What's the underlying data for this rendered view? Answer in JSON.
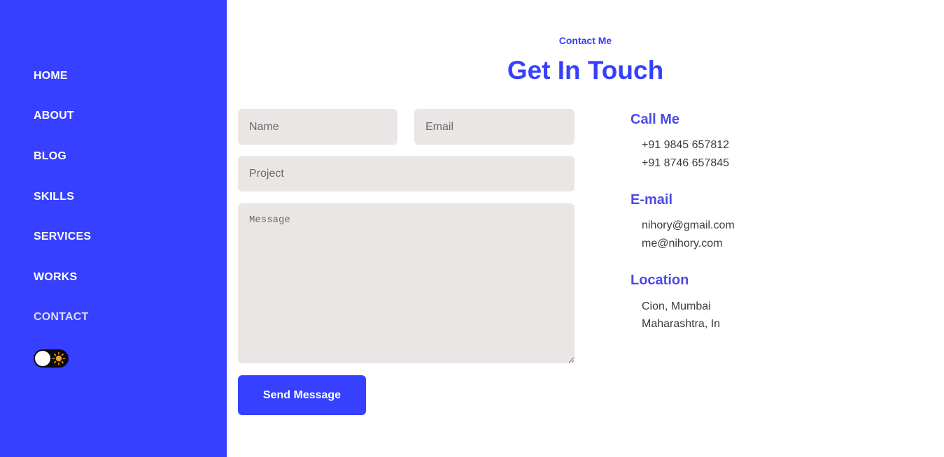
{
  "nav": {
    "items": [
      {
        "label": "HOME"
      },
      {
        "label": "ABOUT"
      },
      {
        "label": "BLOG"
      },
      {
        "label": "SKILLS"
      },
      {
        "label": "SERVICES"
      },
      {
        "label": "WORKS"
      },
      {
        "label": "CONTACT"
      }
    ],
    "active": "CONTACT",
    "theme_toggle": {
      "icon": "sun-icon",
      "state": "light"
    }
  },
  "header": {
    "eyebrow": "Contact Me",
    "title": "Get In Touch"
  },
  "form": {
    "name_placeholder": "Name",
    "email_placeholder": "Email",
    "project_placeholder": "Project",
    "message_placeholder": "Message",
    "submit_label": "Send Message"
  },
  "contact": {
    "call": {
      "title": "Call Me",
      "lines": [
        "+91 9845 657812",
        "+91 8746 657845"
      ]
    },
    "email": {
      "title": "E-mail",
      "lines": [
        "nihory@gmail.com",
        "me@nihory.com"
      ]
    },
    "location": {
      "title": "Location",
      "lines": [
        "Cion, Mumbai",
        "Maharashtra, In"
      ]
    }
  },
  "colors": {
    "accent": "#3640fe",
    "field_bg": "#e9e6e5",
    "info_title": "#4c4ae8"
  }
}
